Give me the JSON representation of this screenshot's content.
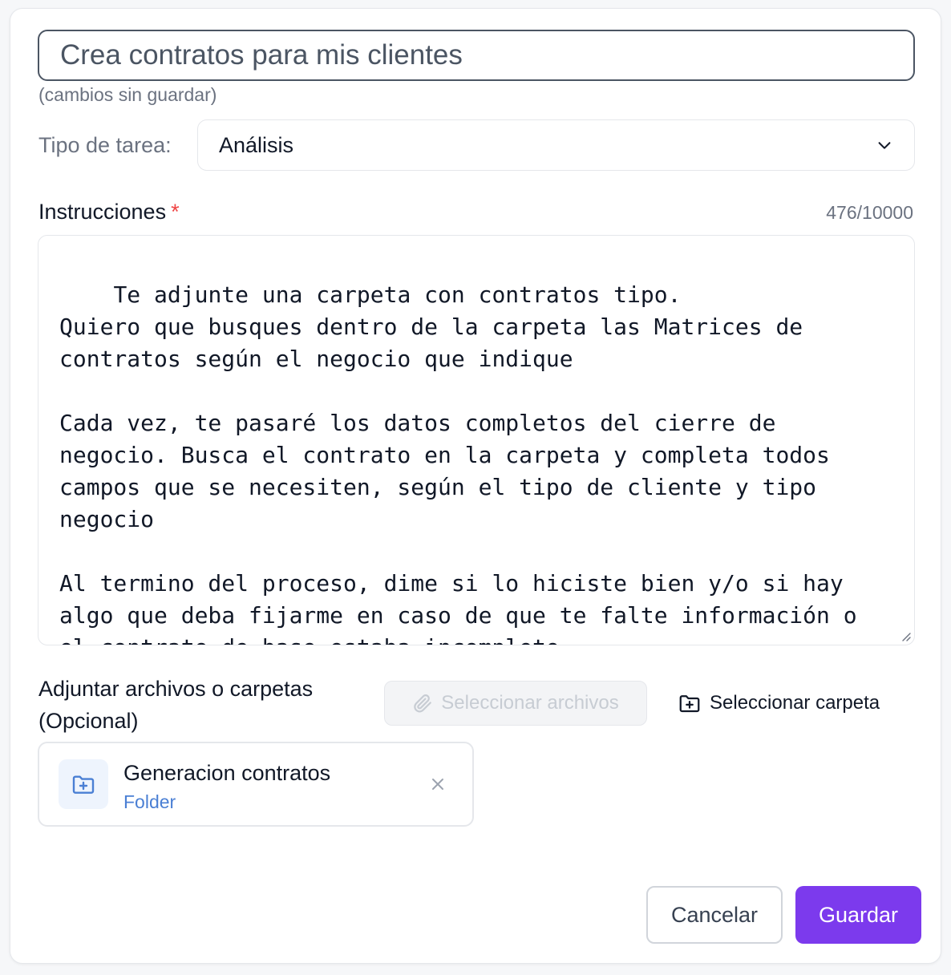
{
  "form": {
    "title_value": "Crea contratos para mis clientes",
    "unsaved_note": "(cambios sin guardar)",
    "task_type_label": "Tipo de tarea:",
    "task_type_value": "Análisis",
    "instructions_label": "Instrucciones",
    "required_mark": "*",
    "char_counter": "476/10000",
    "instructions_text": "Te adjunte una carpeta con contratos tipo.\nQuiero que busques dentro de la carpeta las Matrices de contratos según el negocio que indique\n\nCada vez, te pasaré los datos completos del cierre de negocio. Busca el contrato en la carpeta y completa todos campos que se necesiten, según el tipo de cliente y tipo negocio\n\nAl termino del proceso, dime si lo hiciste bien y/o si hay algo que deba fijarme en caso de que te falte información o el contrato de base estaba incompleto",
    "attach_label": "Adjuntar archivos o carpetas (Opcional)",
    "select_files_label": "Seleccionar archivos",
    "select_folder_label": "Seleccionar carpeta"
  },
  "attachments": [
    {
      "name": "Generacion contratos",
      "type": "Folder",
      "icon": "folder-plus-icon"
    }
  ],
  "actions": {
    "cancel_label": "Cancelar",
    "save_label": "Guardar"
  },
  "colors": {
    "accent": "#7c3aed",
    "required": "#ef4444",
    "folder_type": "#4a7fd4"
  }
}
